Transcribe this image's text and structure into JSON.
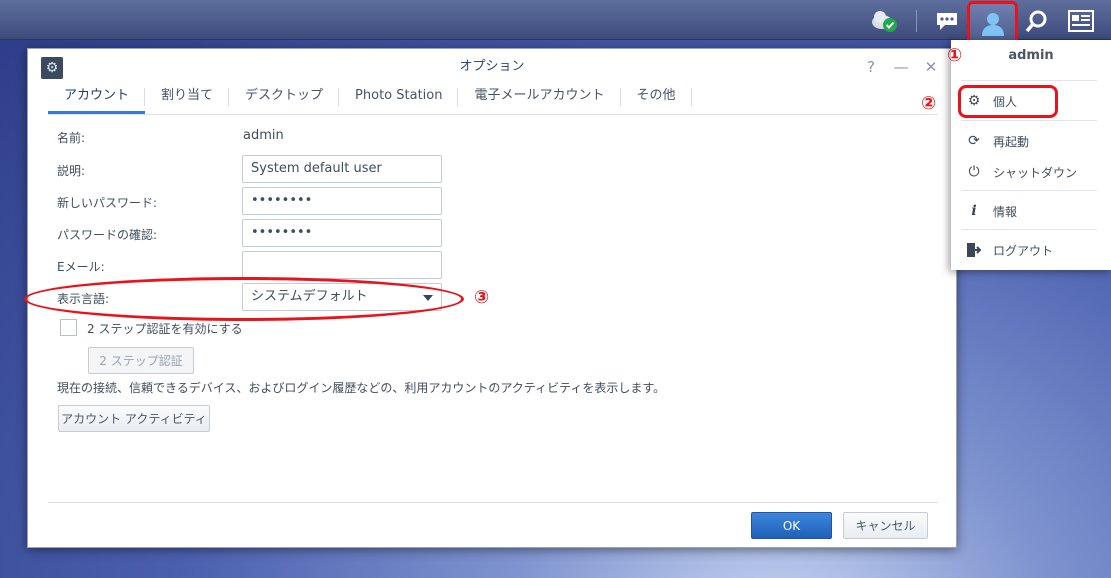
{
  "dialog": {
    "title": "オプション",
    "controls": {
      "help": "?",
      "minimize": "—",
      "close": "✕"
    },
    "tabs": [
      {
        "label": "アカウント",
        "active": true
      },
      {
        "label": "割り当て",
        "active": false
      },
      {
        "label": "デスクトップ",
        "active": false
      },
      {
        "label": "Photo Station",
        "active": false
      },
      {
        "label": "電子メールアカウント",
        "active": false
      },
      {
        "label": "その他",
        "active": false
      }
    ],
    "form": {
      "name_label": "名前:",
      "name_value": "admin",
      "description_label": "説明:",
      "description_value": "System default user",
      "new_password_label": "新しいパスワード:",
      "new_password_value": "••••••••",
      "confirm_password_label": "パスワードの確認:",
      "confirm_password_value": "••••••••",
      "email_label": "Eメール:",
      "email_value": "",
      "language_label": "表示言語:",
      "language_value": "システムデフォルト",
      "two_step_label": "2 ステップ認証を有効にする",
      "two_step_button": "2 ステップ認証",
      "activity_text": "現在の接続、信頼できるデバイス、およびログイン履歴などの、利用アカウントのアクティビティを表示します。",
      "activity_button": "アカウント アクティビティ"
    },
    "footer": {
      "ok": "OK",
      "cancel": "キャンセル"
    }
  },
  "menu": {
    "user": "admin",
    "items": [
      {
        "label": "個人",
        "icon": "gear-icon"
      },
      {
        "label": "再起動",
        "icon": "restart-icon"
      },
      {
        "label": "シャットダウン",
        "icon": "power-icon"
      },
      {
        "label": "情報",
        "icon": "info-icon"
      },
      {
        "label": "ログアウト",
        "icon": "logout-icon"
      }
    ]
  },
  "annotations": {
    "one": "①",
    "two": "②",
    "three": "③"
  },
  "colors": {
    "highlight": "#e8141b",
    "accent": "#3a7ad7"
  }
}
